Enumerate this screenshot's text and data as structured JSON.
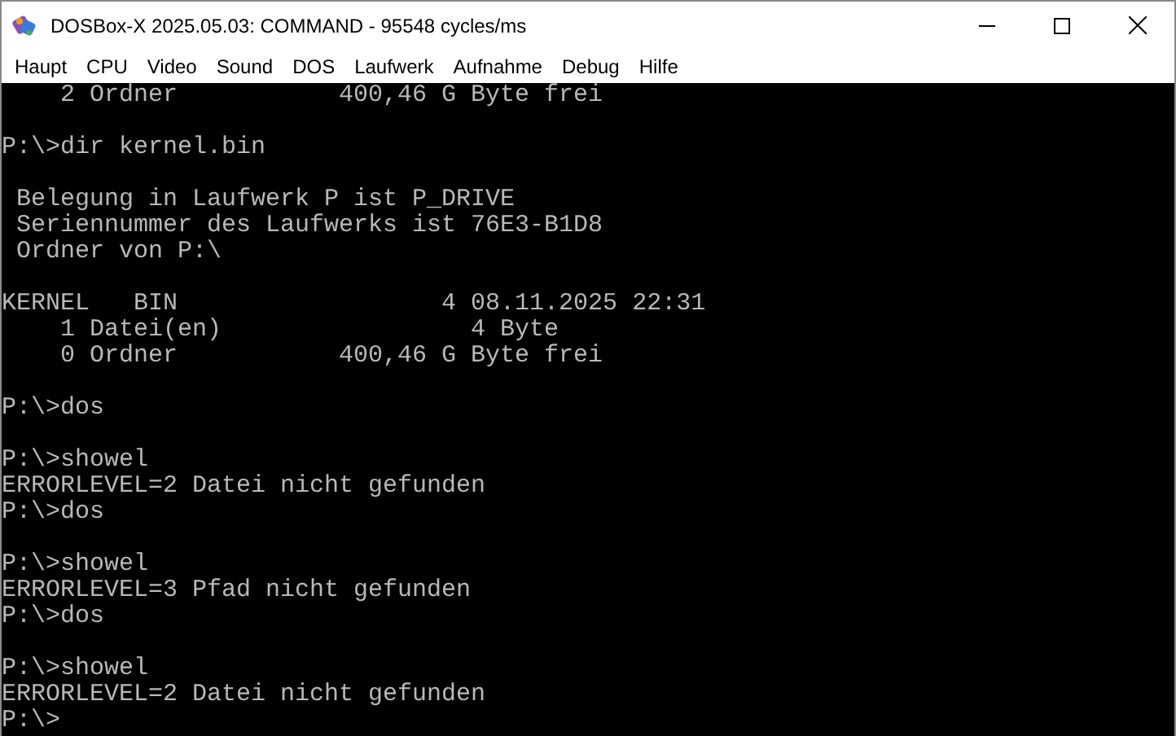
{
  "window": {
    "title": "DOSBox-X 2025.05.03: COMMAND - 95548 cycles/ms"
  },
  "menu": [
    "Haupt",
    "CPU",
    "Video",
    "Sound",
    "DOS",
    "Laufwerk",
    "Aufnahme",
    "Debug",
    "Hilfe"
  ],
  "console_lines": [
    {
      "kind": "text",
      "text": "    2 Ordner           400,46 G Byte frei"
    },
    {
      "kind": "blank"
    },
    {
      "kind": "text",
      "text": "P:\\>dir kernel.bin"
    },
    {
      "kind": "blank"
    },
    {
      "kind": "text",
      "text": " Belegung in Laufwerk P ist P_DRIVE"
    },
    {
      "kind": "text",
      "text": " Seriennummer des Laufwerks ist 76E3-B1D8"
    },
    {
      "kind": "text",
      "text": " Ordner von P:\\"
    },
    {
      "kind": "blank"
    },
    {
      "kind": "text",
      "text": "KERNEL   BIN                  4 08.11.2025 22:31"
    },
    {
      "kind": "text",
      "text": "    1 Datei(en)                 4 Byte"
    },
    {
      "kind": "text",
      "text": "    0 Ordner           400,46 G Byte frei"
    },
    {
      "kind": "blank"
    },
    {
      "kind": "text",
      "text": "P:\\>dos"
    },
    {
      "kind": "blank"
    },
    {
      "kind": "text",
      "text": "P:\\>showel"
    },
    {
      "kind": "text",
      "text": "ERRORLEVEL=2 Datei nicht gefunden"
    },
    {
      "kind": "text",
      "text": "P:\\>dos"
    },
    {
      "kind": "blank"
    },
    {
      "kind": "text",
      "text": "P:\\>showel"
    },
    {
      "kind": "text",
      "text": "ERRORLEVEL=3 Pfad nicht gefunden"
    },
    {
      "kind": "text",
      "text": "P:\\>dos"
    },
    {
      "kind": "blank"
    },
    {
      "kind": "text",
      "text": "P:\\>showel"
    },
    {
      "kind": "text",
      "text": "ERRORLEVEL=2 Datei nicht gefunden"
    },
    {
      "kind": "text",
      "text": "P:\\>"
    }
  ]
}
